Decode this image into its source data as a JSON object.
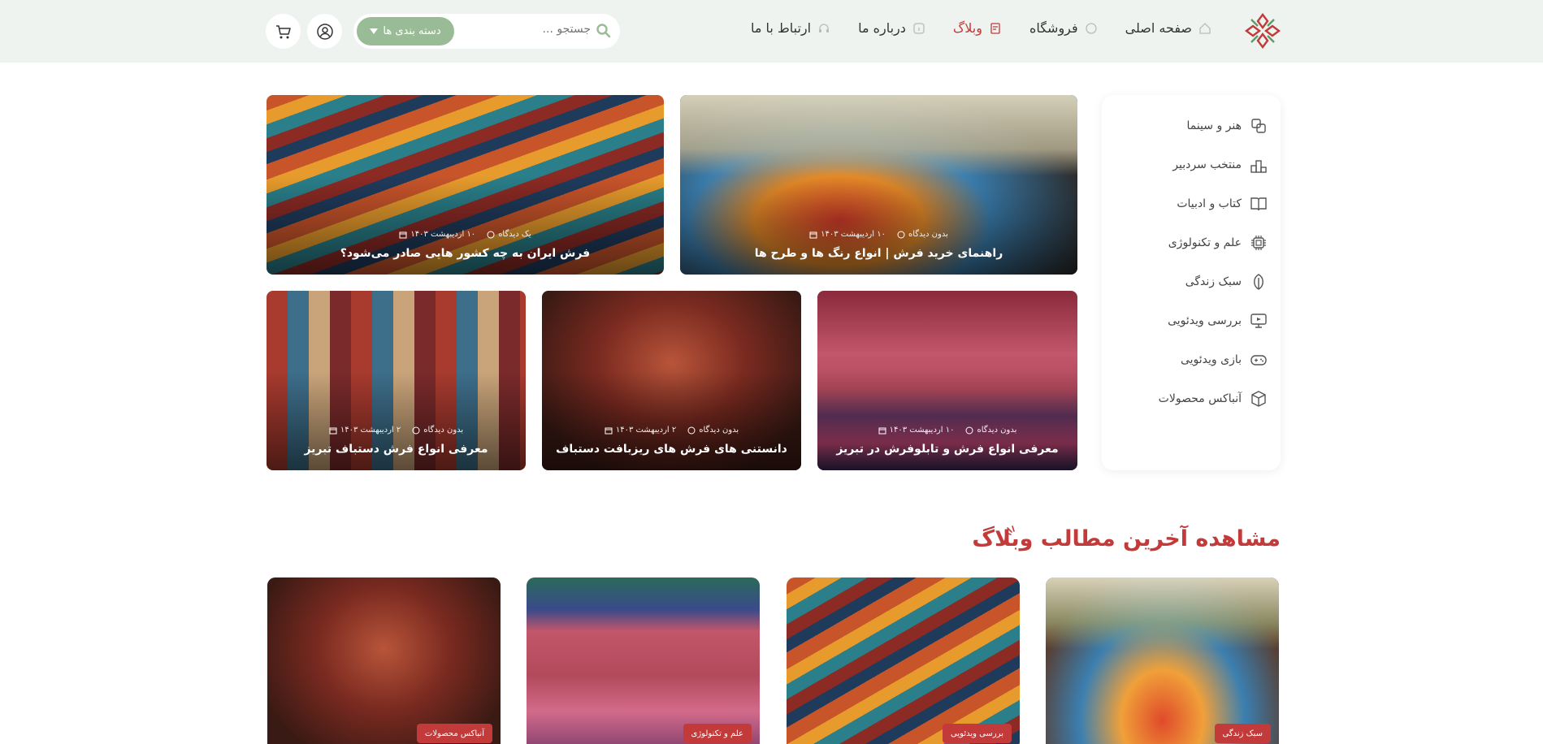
{
  "nav": {
    "home": "صفحه اصلی",
    "shop": "فروشگاه",
    "blog": "وبلاگ",
    "about": "درباره ما",
    "contact": "ارتباط با ما"
  },
  "search": {
    "placeholder": "جستجو ...",
    "category_button": "دسته بندی ها"
  },
  "sidebar": {
    "items": [
      {
        "label": "هنر و سینما",
        "icon": "art-icon"
      },
      {
        "label": "منتخب سردبیر",
        "icon": "editor-pick-icon"
      },
      {
        "label": "کتاب و ادبیات",
        "icon": "book-icon"
      },
      {
        "label": "علم و تکنولوژی",
        "icon": "chip-icon"
      },
      {
        "label": "سبک زندگی",
        "icon": "leaf-icon"
      },
      {
        "label": "بررسی ویدئویی",
        "icon": "video-review-icon"
      },
      {
        "label": "بازی ویدئویی",
        "icon": "gamepad-icon"
      },
      {
        "label": "آنباکس محصولات",
        "icon": "box-icon"
      }
    ]
  },
  "featured": [
    {
      "title": "راهنمای خرید فرش | انواع رنگ ها و طرح ها",
      "date": "۱۰ اردیبهشت ۱۴۰۳",
      "comments": "بدون دیدگاه"
    },
    {
      "title": "فرش ایران به چه کشور هایی صادر می‌شود؟",
      "date": "۱۰ اردیبهشت ۱۴۰۳",
      "comments": "یک دیدگاه"
    },
    {
      "title": "معرفی انواع فرش و تابلوفرش در تبریز",
      "date": "۱۰ اردیبهشت ۱۴۰۳",
      "comments": "بدون دیدگاه"
    },
    {
      "title": "دانستنی های فرش های ریزبافت دستباف",
      "date": "۲ اردیبهشت ۱۴۰۳",
      "comments": "بدون دیدگاه"
    },
    {
      "title": "معرفی انواع فرش دستباف تبریز",
      "date": "۲ اردیبهشت ۱۴۰۳",
      "comments": "بدون دیدگاه"
    }
  ],
  "latest": {
    "heading": "مشاهده آخرین مطالب وبلاگ",
    "posts": [
      {
        "category": "سبک زندگی"
      },
      {
        "category": "بررسی ویدئویی"
      },
      {
        "category": "علم و تکنولوژی"
      },
      {
        "category": "آنباکس محصولات"
      }
    ]
  },
  "colors": {
    "accent": "#c23a3a",
    "header_bg": "#eef3ef",
    "category_button": "#99bc97"
  }
}
